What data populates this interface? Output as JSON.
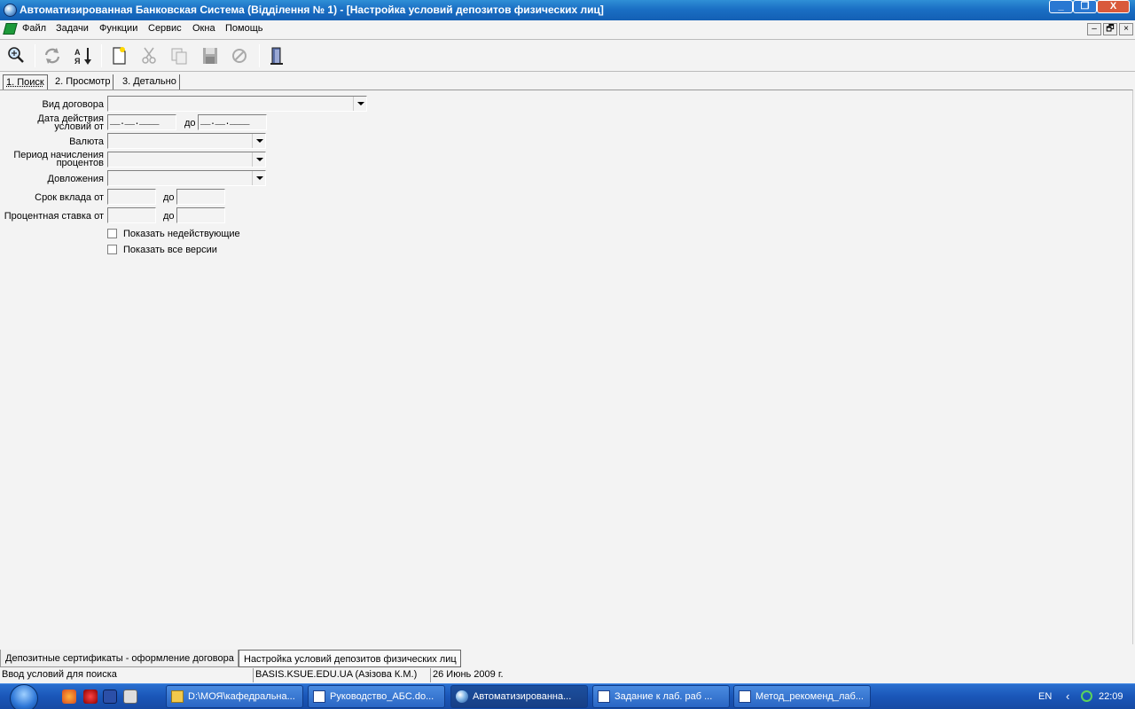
{
  "window": {
    "title": "Автоматизированная Банковская Система (Відділення № 1) - [Настройка условий депозитов физических лиц]",
    "minimize_symbol": "_",
    "maximize_symbol": "❐",
    "close_symbol": "X"
  },
  "menu": {
    "items": [
      "Файл",
      "Задачи",
      "Функции",
      "Сервис",
      "Окна",
      "Помощь"
    ],
    "mdi_controls": [
      "–",
      "🗗",
      "×"
    ]
  },
  "toolbar": {
    "buttons": [
      "search-icon",
      "refresh-icon",
      "sort-icon",
      "new-document-icon",
      "cut-icon",
      "copy-icon",
      "save-icon",
      "cancel-icon",
      "exit-door-icon"
    ]
  },
  "tabs": [
    "1. Поиск",
    "2. Просмотр",
    "3. Детально"
  ],
  "form": {
    "contract_type_label": "Вид договора",
    "date_from_label_1": "Дата действия",
    "date_from_label_2": "условий от",
    "date_to_label": "до",
    "date_mask": "__.__.____",
    "currency_label": "Валюта",
    "interest_period_label_1": "Период начисления",
    "interest_period_label_2": "процентов",
    "additional_deposits_label": "Довложения",
    "term_from_label": "Срок вклада от",
    "term_to_label": "до",
    "rate_from_label": "Процентная ставка от",
    "rate_to_label": "до",
    "show_inactive_label": "Показать недействующие",
    "show_all_versions_label": "Показать все версии"
  },
  "mdi_tabs": [
    "Депозитные сертификаты - оформление договора",
    "Настройка условий депозитов физических лиц"
  ],
  "status": {
    "hint": "Ввод условий для поиска",
    "server_user": "BASIS.KSUE.EDU.UA (Азізова К.М.)",
    "date": "26 Июнь 2009 г."
  },
  "taskbar": {
    "tasks": [
      "D:\\МОЯ\\кафедральна...",
      "Руководство_АБС.do...",
      "Автоматизированна...",
      "Задание к лаб. раб ...",
      "Метод_рекоменд_лаб..."
    ],
    "language": "EN",
    "clock": "22:09"
  }
}
